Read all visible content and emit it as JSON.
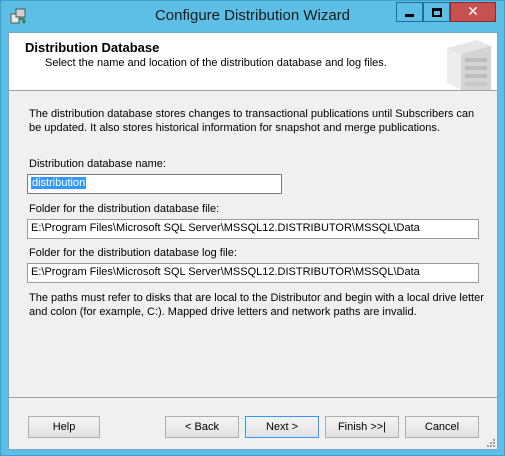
{
  "window": {
    "title": "Configure Distribution Wizard",
    "close_glyph": "✕"
  },
  "header": {
    "title": "Distribution Database",
    "subtitle": "Select the name and location of the distribution database and log files."
  },
  "description": "The distribution database stores changes to transactional publications until Subscribers can be updated. It also stores historical information for snapshot and merge publications.",
  "fields": {
    "db_name_label": "Distribution database name:",
    "db_name_value": "distribution",
    "data_folder_label": "Folder for the distribution database file:",
    "data_folder_value": "E:\\Program Files\\Microsoft SQL Server\\MSSQL12.DISTRIBUTOR\\MSSQL\\Data",
    "log_folder_label": "Folder for the distribution database log file:",
    "log_folder_value": "E:\\Program Files\\Microsoft SQL Server\\MSSQL12.DISTRIBUTOR\\MSSQL\\Data"
  },
  "note": "The paths must refer to disks that are local to the Distributor and begin with a local drive letter and colon (for example, C:). Mapped drive letters and network paths are invalid.",
  "buttons": {
    "help": "Help",
    "back": "< Back",
    "next": "Next >",
    "finish": "Finish >>|",
    "cancel": "Cancel"
  },
  "colors": {
    "titlebar": "#5ebfe6",
    "close_button": "#c75050",
    "selection": "#3399ff"
  },
  "icons": [
    "wizard-app-icon",
    "minimize-icon",
    "maximize-icon",
    "close-icon",
    "server-illustration-icon",
    "resize-grip-icon"
  ]
}
